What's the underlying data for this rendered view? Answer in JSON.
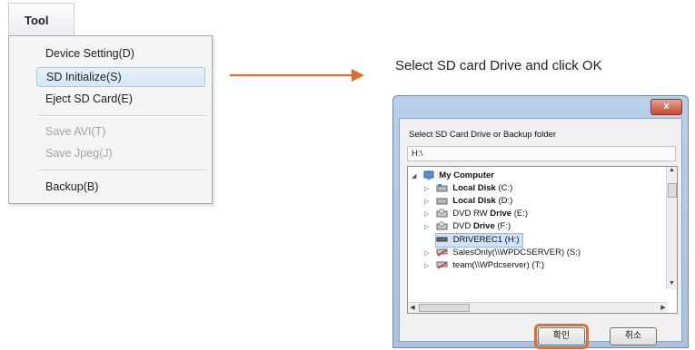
{
  "tool_menu": {
    "title": "Tool",
    "items": [
      {
        "label": "Device Setting(D)",
        "enabled": true
      },
      {
        "label": "SD Initialize(S)",
        "enabled": true,
        "highlighted": true
      },
      {
        "label": "Eject SD Card(E)",
        "enabled": true
      },
      {
        "label": "Save AVI(T)",
        "enabled": false
      },
      {
        "label": "Save Jpeg(J)",
        "enabled": false
      },
      {
        "label": "Backup(B)",
        "enabled": true
      }
    ]
  },
  "caption": "Select SD card Drive and click OK",
  "dialog": {
    "close_label": "x",
    "prompt": "Select SD Card Drive or Backup folder",
    "path_value": "H:\\",
    "tree": [
      {
        "name": "My Computer",
        "level": 0,
        "icon": "computer-icon",
        "bold": true
      },
      {
        "name": "Local Disk",
        "suffix": "(C:)",
        "level": 1,
        "icon": "local-disk-icon"
      },
      {
        "name": "Local Disk",
        "suffix": "(D:)",
        "level": 1,
        "icon": "local-disk-icon"
      },
      {
        "prefix": "DVD RW ",
        "name": "Drive",
        "suffix": "(E:)",
        "level": 1,
        "icon": "dvd-drive-icon"
      },
      {
        "prefix": "DVD ",
        "name": "Drive",
        "suffix": "(F:)",
        "level": 1,
        "icon": "dvd-drive-icon"
      },
      {
        "name": "DRIVEREC1 (H:)",
        "level": 1,
        "icon": "removable-drive-icon",
        "selected": true
      },
      {
        "name": "SalesOnly(\\\\WPDCSERVER) (S:)",
        "level": 1,
        "icon": "network-drive-icon"
      },
      {
        "name": "team(\\\\WPdcserver) (T:)",
        "level": 1,
        "icon": "network-drive-icon"
      }
    ],
    "ok_label": "확인",
    "cancel_label": "취소"
  },
  "colors": {
    "arrow": "#e06d2c",
    "ok_highlight": "#e06d2c"
  }
}
